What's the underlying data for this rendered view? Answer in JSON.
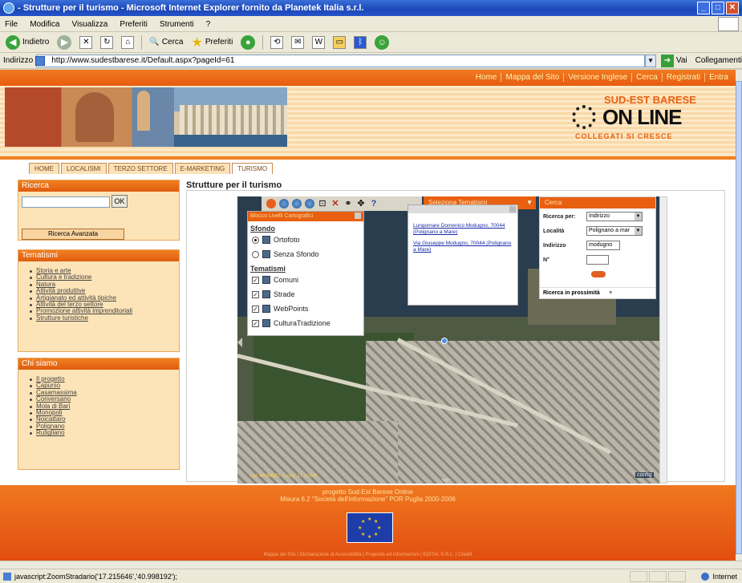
{
  "window": {
    "title": "- Strutture per il turismo - Microsoft Internet Explorer fornito da Planetek Italia s.r.l."
  },
  "menu": [
    "File",
    "Modifica",
    "Visualizza",
    "Preferiti",
    "Strumenti",
    "?"
  ],
  "toolbar": {
    "back_label": "Indietro",
    "search_label": "Cerca",
    "favorites_label": "Preferiti"
  },
  "address": {
    "label": "Indirizzo",
    "url": "http://www.sudestbarese.it/Default.aspx?pageId=61",
    "go_label": "Vai",
    "links_label": "Collegamenti"
  },
  "site": {
    "top_links": [
      "Home",
      "Mappa del Sito",
      "Versione Inglese",
      "Cerca",
      "Registrati",
      "Entra"
    ],
    "logo": {
      "top": "SUD-EST BARESE",
      "main": "ON LINE",
      "sub": "COLLEGATI SI CRESCE"
    },
    "tabs": [
      "HOME",
      "LOCALISMI",
      "TERZO SETTORE",
      "E-MARKETING",
      "TURISMO"
    ],
    "active_tab": "TURISMO"
  },
  "sidebar": {
    "search": {
      "title": "Ricerca",
      "ok_label": "OK",
      "advanced_label": "Ricerca Avanzata"
    },
    "themes": {
      "title": "Tematismi",
      "items": [
        "Storia e arte",
        "Cultura e tradizione",
        "Natura",
        "Attività produttive",
        "Artigianato ed attività tipiche",
        "Attività del terzo settore",
        "Promozione attività imprenditoriali",
        "Strutture turistiche"
      ]
    },
    "about": {
      "title": "Chi siamo",
      "items": [
        "Il progetto",
        "Capurso",
        "Casamassima",
        "Conversano",
        "Mola di Bari",
        "Monopoli",
        "Noicattaro",
        "Polignano",
        "Rutigliano"
      ]
    }
  },
  "main": {
    "title": "Strutture per il turismo",
    "themes_select": "Seleziona Tematismi",
    "layer_panel": {
      "title": "Blocco Livelli Cartografici",
      "background_heading": "Sfondo",
      "backgrounds": [
        {
          "label": "Ortofoto",
          "selected": true
        },
        {
          "label": "Senza Sfondo",
          "selected": false
        }
      ],
      "themes_heading": "Tematismi",
      "layers": [
        "Comuni",
        "Strade",
        "WebPoints",
        "CulturaTradizione"
      ]
    },
    "popup_links": [
      "Lungomare Domenico Modugno, 70044 (Polignano a Mare)",
      "Via Giuseppe Modugno, 70044 (Polignano a Mare)"
    ],
    "search_panel": {
      "title": "Cerca",
      "search_by_label": "Ricerca per:",
      "search_by_value": "Indirizzo",
      "locality_label": "Località",
      "locality_value": "Polignano a mar",
      "address_label": "Indirizzo",
      "address_value": "modugno",
      "number_label": "N°",
      "nearby_label": "Ricerca in prossimità"
    },
    "scale_label": "Lat: 40.99582 - Long: 17.21646",
    "corner_label": "config"
  },
  "footer": {
    "line1": "progetto Sud-Est Barese Online",
    "line2": "Misura 6.2 \"Società dell'informazione\" POR Puglia 2000-2006",
    "links": "Mappa del Sito | Dichiarazione di Accessibilità | Proprietà ed Informazioni | EDITAL S.R.L. | Crediti"
  },
  "status": {
    "text": "javascript:ZoomStradario('17.215646','40.998192');",
    "zone": "Internet"
  }
}
